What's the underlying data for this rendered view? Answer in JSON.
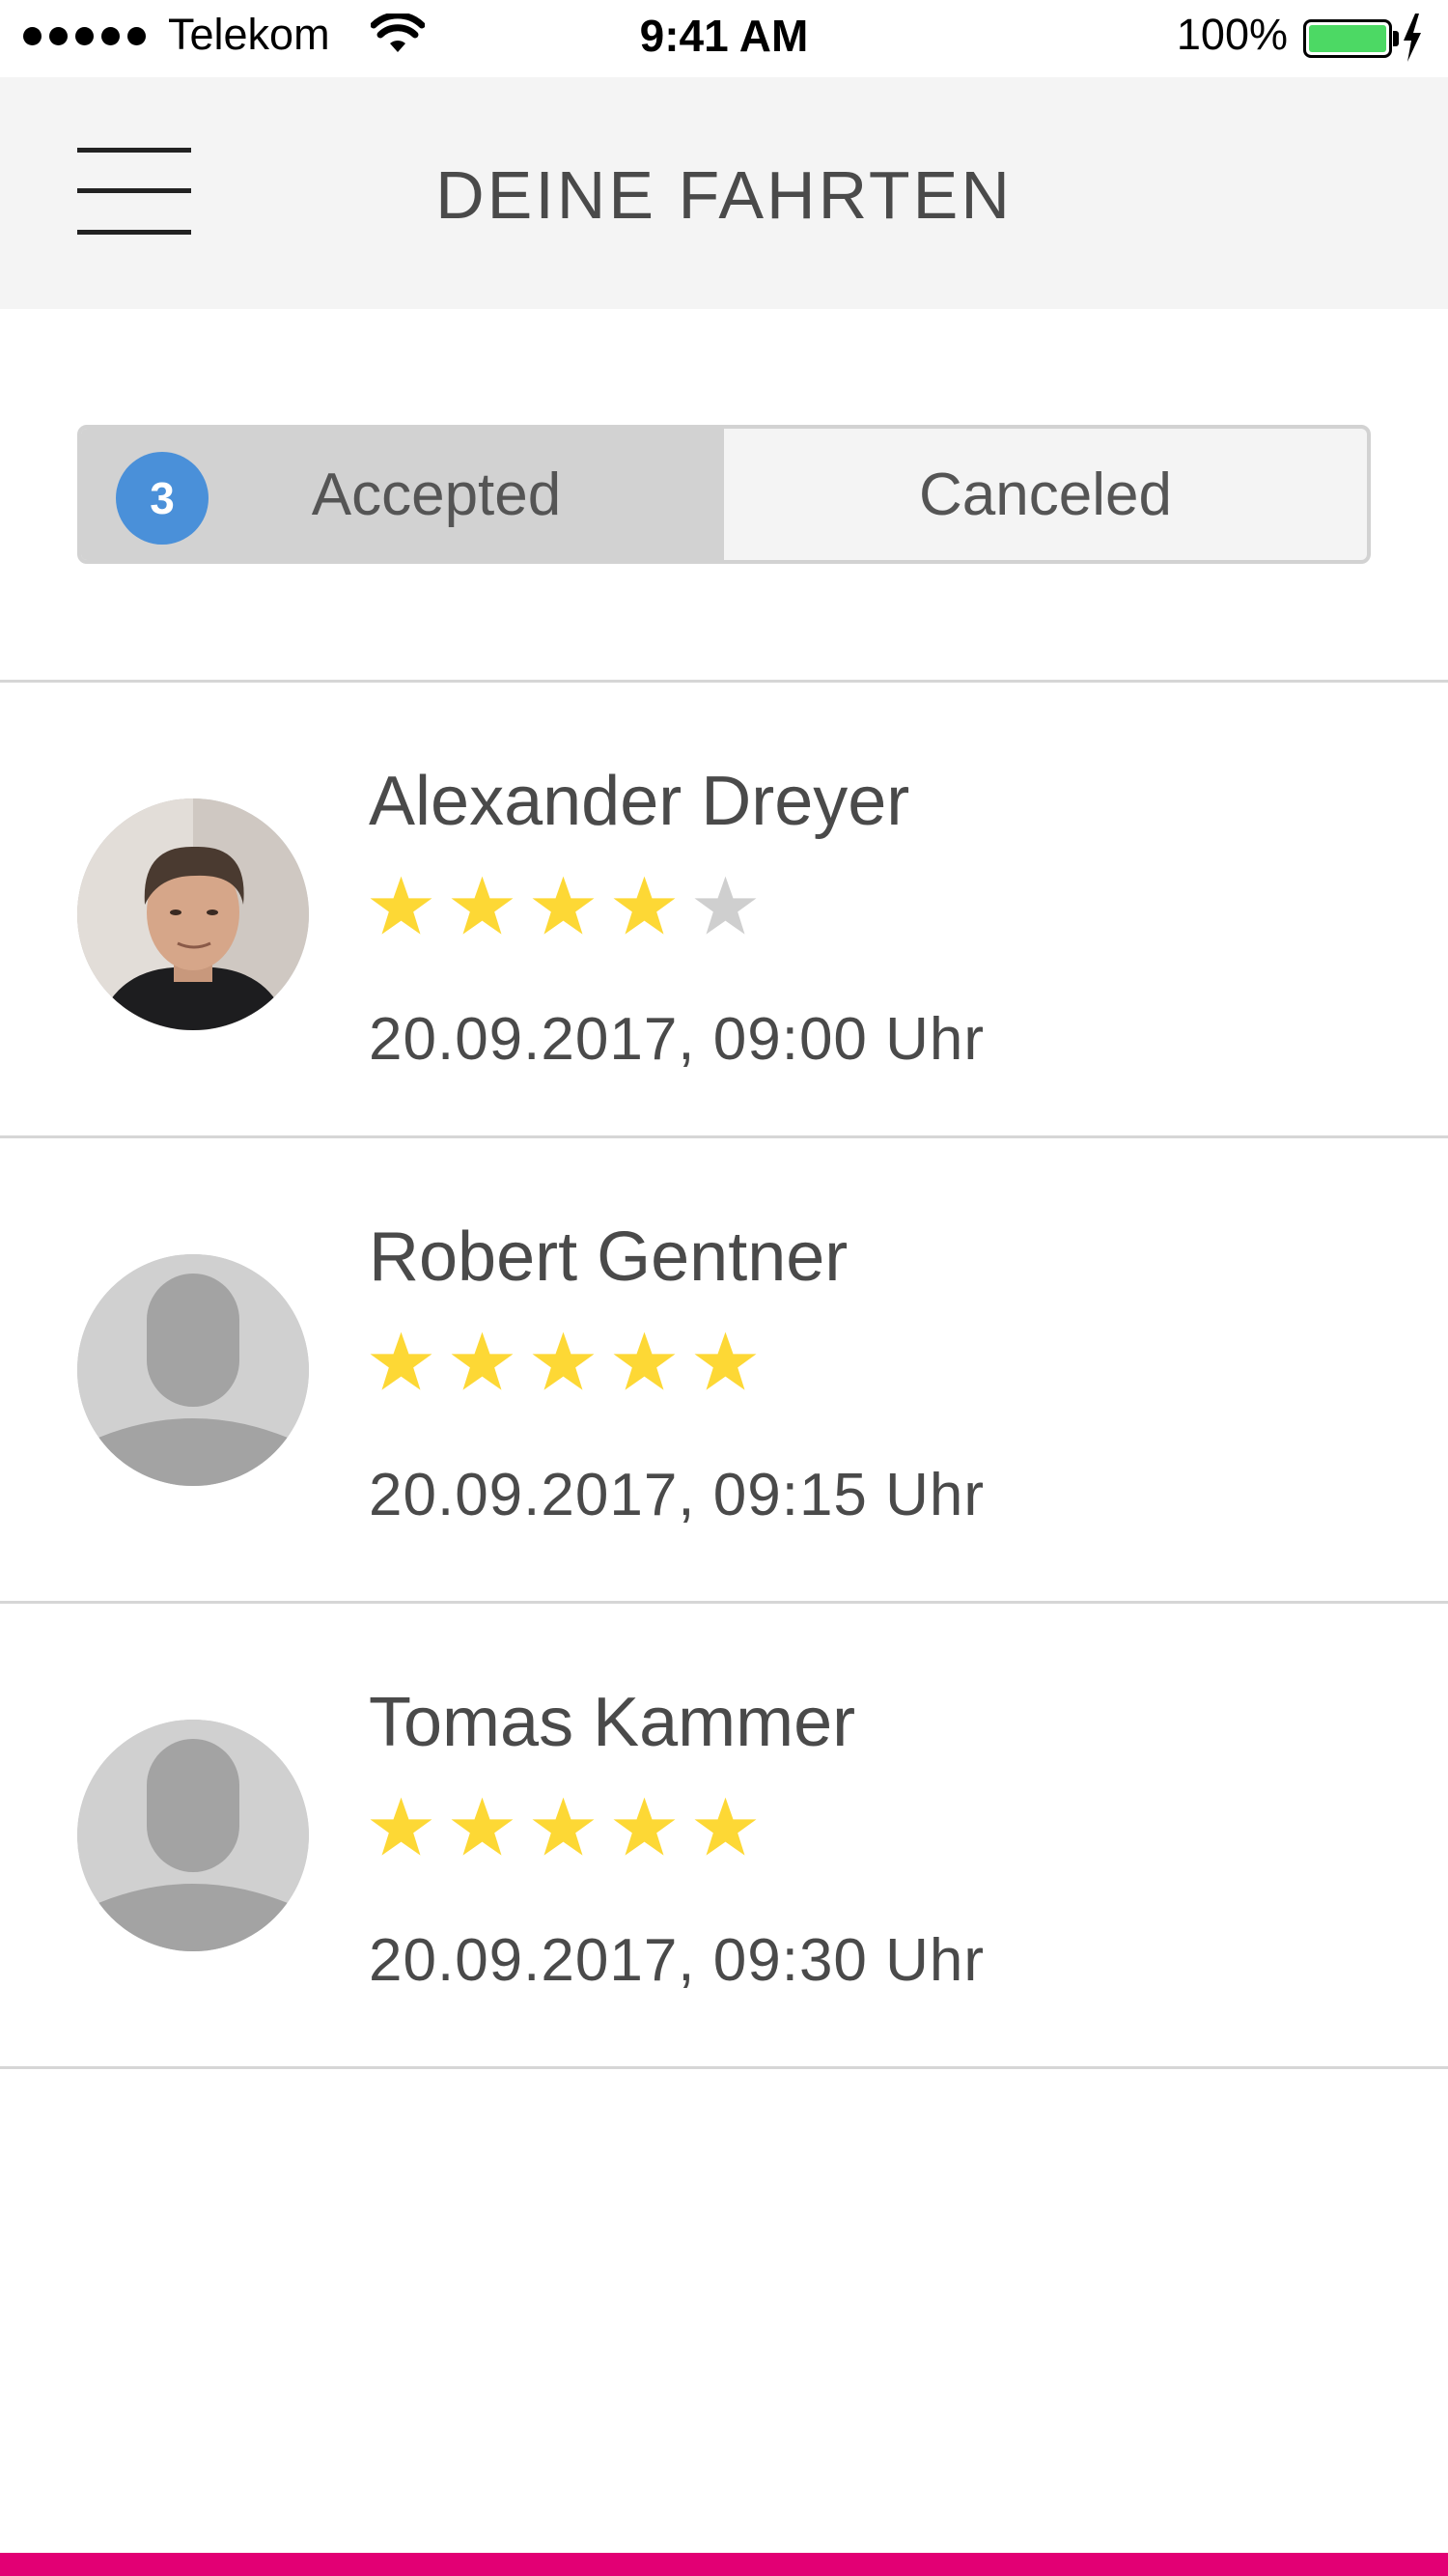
{
  "status_bar": {
    "carrier": "Telekom",
    "time": "9:41 AM",
    "battery": "100%",
    "battery_level": 1.0,
    "signal_bars": 5
  },
  "header": {
    "title": "DEINE FAHRTEN",
    "menu_icon": "hamburger-menu-icon"
  },
  "tabs": {
    "accepted": {
      "label": "Accepted",
      "badge": "3",
      "selected": true
    },
    "canceled": {
      "label": "Canceled",
      "selected": false
    }
  },
  "rides": [
    {
      "name": "Alexander Dreyer",
      "rating": 4,
      "max_rating": 5,
      "datetime": "20.09.2017, 09:00 Uhr",
      "avatar": "photo"
    },
    {
      "name": "Robert Gentner",
      "rating": 5,
      "max_rating": 5,
      "datetime": "20.09.2017, 09:15 Uhr",
      "avatar": "placeholder"
    },
    {
      "name": "Tomas Kammer",
      "rating": 5,
      "max_rating": 5,
      "datetime": "20.09.2017, 09:30 Uhr",
      "avatar": "placeholder"
    }
  ],
  "colors": {
    "header_bg": "#f4f4f4",
    "star_filled": "#fdd835",
    "star_empty": "#cfcfcf",
    "badge": "#4a90d9",
    "accent": "#e20074",
    "battery": "#4cd964"
  }
}
